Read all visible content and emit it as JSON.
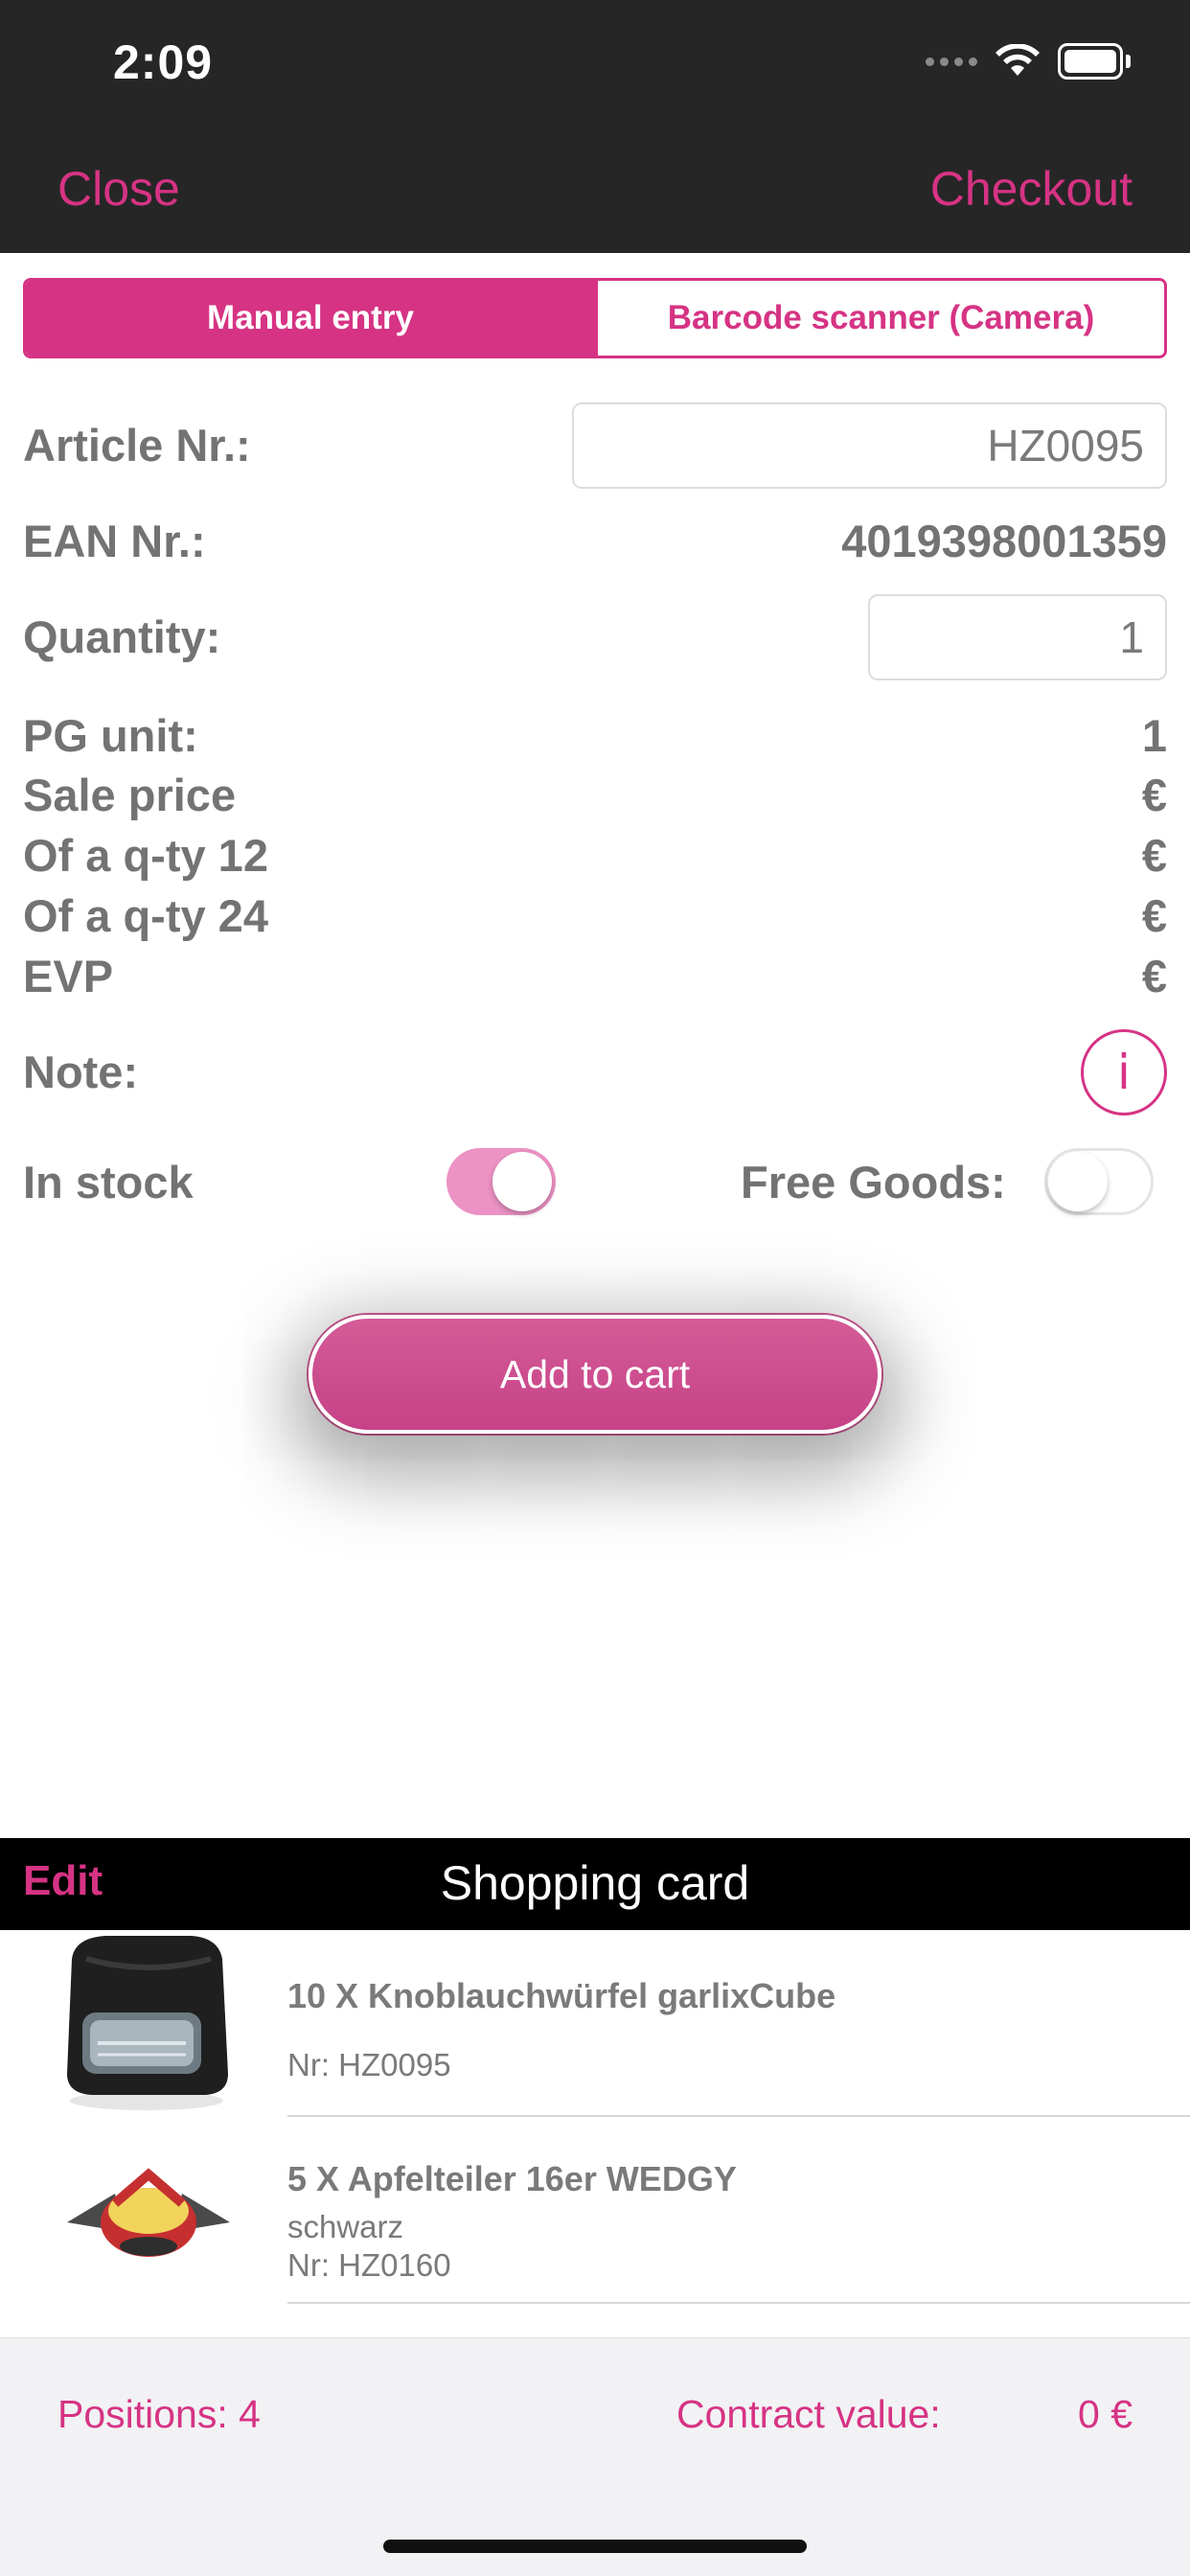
{
  "status_bar": {
    "time": "2:09"
  },
  "nav": {
    "close_label": "Close",
    "checkout_label": "Checkout"
  },
  "segmented": {
    "manual_label": "Manual entry",
    "barcode_label": "Barcode scanner (Camera)",
    "selected": "Manual entry"
  },
  "form": {
    "article_label": "Article Nr.:",
    "article_value": "HZ0095",
    "ean_label": "EAN Nr.:",
    "ean_value": "4019398001359",
    "quantity_label": "Quantity:",
    "quantity_value": "1",
    "pg_unit_label": "PG unit:",
    "pg_unit_value": "1",
    "sale_price_label": "Sale price",
    "sale_price_value": "€",
    "qty12_label": "Of a q-ty 12",
    "qty12_value": "€",
    "qty24_label": "Of a q-ty 24",
    "qty24_value": "€",
    "evp_label": "EVP",
    "evp_value": "€",
    "note_label": "Note:",
    "info_glyph": "i",
    "in_stock_label": "In stock",
    "in_stock_on": true,
    "free_goods_label": "Free Goods:",
    "free_goods_on": false
  },
  "add_to_cart_label": "Add to cart",
  "cart": {
    "edit_label": "Edit",
    "title": "Shopping card",
    "items": [
      {
        "title": "10 X Knoblauchwürfel garlixCube",
        "variant": "",
        "number": "Nr: HZ0095",
        "thumb": "garlic-cube-product"
      },
      {
        "title": "5 X Apfelteiler 16er WEDGY",
        "variant": "schwarz",
        "number": "Nr: HZ0160",
        "thumb": "apple-slicer-product"
      }
    ]
  },
  "footer": {
    "positions": "Positions: 4",
    "contract_label": "Contract value:",
    "contract_value": "0 €"
  },
  "colors": {
    "accent": "#d63384",
    "topbar": "#262626",
    "toggle_on": "#ec92c4"
  }
}
